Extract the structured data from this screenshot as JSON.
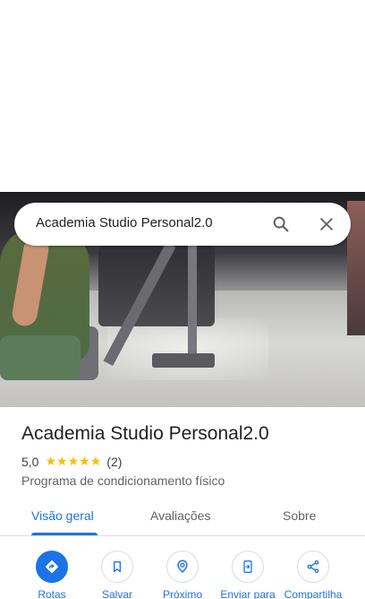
{
  "search": {
    "query": "Academia Studio Personal2.0",
    "search_icon": "search-icon",
    "close_icon": "close-icon"
  },
  "place": {
    "name": "Academia Studio Personal2.0",
    "rating": "5,0",
    "stars": [
      "★",
      "★",
      "★",
      "★",
      "★"
    ],
    "review_count": "(2)",
    "category": "Programa de condicionamento físico"
  },
  "tabs": [
    {
      "label": "Visão geral",
      "active": true
    },
    {
      "label": "Avaliações",
      "active": false
    },
    {
      "label": "Sobre",
      "active": false
    }
  ],
  "actions": [
    {
      "label": "Rotas",
      "icon": "directions-icon"
    },
    {
      "label": "Salvar",
      "icon": "bookmark-icon"
    },
    {
      "label": "Próximo",
      "icon": "nearby-icon"
    },
    {
      "label": "Enviar para",
      "icon": "send-to-phone-icon"
    },
    {
      "label": "Compartilha",
      "icon": "share-icon"
    }
  ],
  "colors": {
    "accent": "#1a73e8",
    "star": "#fbbc04",
    "text": "#202124",
    "muted": "#5f6368"
  }
}
